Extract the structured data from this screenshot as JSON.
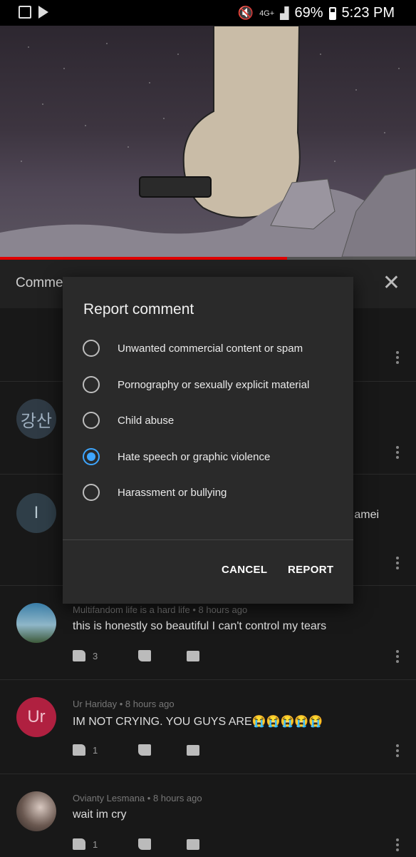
{
  "status_bar": {
    "battery": "69%",
    "time": "5:23 PM",
    "network": "4G+"
  },
  "video": {
    "progress_percent": 69
  },
  "comments_panel": {
    "title": "Comme",
    "comments": [
      {
        "avatar_text": "강산",
        "avatar_color": "#2f3a44"
      },
      {
        "avatar_text": "I",
        "avatar_color": "#2f3e48",
        "partial_text": "u amei"
      },
      {
        "author": "Multifandom life is a hard life",
        "age": "8 hours ago",
        "text": "this is honestly so beautiful I can't control my tears",
        "likes": "3"
      },
      {
        "avatar_text": "Ur",
        "avatar_color": "#b02040",
        "author": "Ur Hariday",
        "age": "8 hours ago",
        "text": "IM NOT CRYING. YOU GUYS ARE😭😭😭😭😭",
        "likes": "1"
      },
      {
        "author": "Ovianty Lesmana",
        "age": "8 hours ago",
        "text": "wait im cry",
        "likes": "1"
      }
    ]
  },
  "dialog": {
    "title": "Report comment",
    "options": [
      {
        "label": "Unwanted commercial content or spam",
        "checked": false
      },
      {
        "label": "Pornography or sexually explicit material",
        "checked": false
      },
      {
        "label": "Child abuse",
        "checked": false
      },
      {
        "label": "Hate speech or graphic violence",
        "checked": true
      },
      {
        "label": "Harassment or bullying",
        "checked": false
      }
    ],
    "cancel_label": "CANCEL",
    "report_label": "REPORT"
  },
  "colors": {
    "accent": "#3ea6ff",
    "progress": "#e00000",
    "dialog_bg": "#2a2a2a"
  }
}
